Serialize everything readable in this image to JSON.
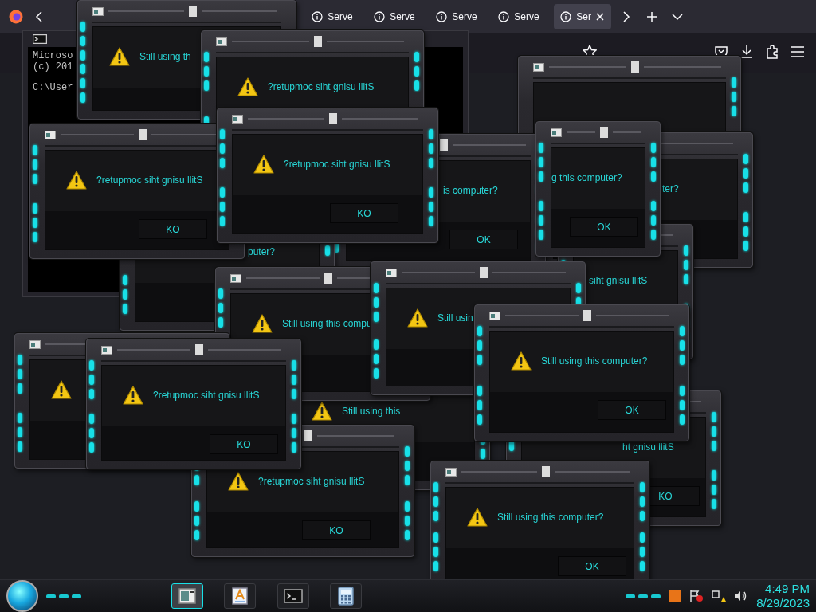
{
  "browser": {
    "tabs": [
      {
        "label": "Serve",
        "selected": false
      },
      {
        "label": "Serve",
        "selected": false
      },
      {
        "label": "Serve",
        "selected": false
      },
      {
        "label": "Serve",
        "selected": false
      },
      {
        "label": "Ser",
        "selected": true
      }
    ]
  },
  "console": {
    "lines": [
      "Microso",
      "(c) 201",
      "C:\\User"
    ]
  },
  "dialogs": [
    {
      "icon": true,
      "message": "Still using th"
    },
    {
      "icon": true,
      "message": "?retupmoc siht gnisu llitS"
    },
    {
      "icon": false
    },
    {
      "icon": false,
      "message": "ter?"
    },
    {
      "icon": false,
      "message": "g this computer?",
      "button": "OK"
    },
    {
      "icon": false,
      "message": "is computer?",
      "button": "OK"
    },
    {
      "icon": false,
      "message": "puter?"
    },
    {
      "icon": true,
      "message": "?retupmoc siht gnisu llitS",
      "button": "KO"
    },
    {
      "icon": true,
      "message": "?retupmoc siht gnisu llitS",
      "button": "KO"
    },
    {
      "icon": true,
      "message": "Still using this"
    },
    {
      "icon": false,
      "message": "siht gnisu llitS"
    },
    {
      "icon": true,
      "message": "Still using this compu"
    },
    {
      "icon": true,
      "message": "Still usin"
    },
    {
      "icon": true,
      "message": "Still using this computer?",
      "button": "OK"
    },
    {
      "icon": true
    },
    {
      "icon": true,
      "message": "?retupmoc siht gnisu llitS",
      "button": "KO"
    },
    {
      "icon": true,
      "message": "?retupmoc siht gnisu llitS",
      "button": "KO"
    },
    {
      "icon": false,
      "message": "ht gnisu llitS",
      "button": "KO"
    },
    {
      "icon": true,
      "message": "Still using this computer?",
      "button": "OK"
    }
  ],
  "taskbar": {
    "apps": [
      {
        "kind": "window",
        "selected": true
      },
      {
        "kind": "editor",
        "selected": false
      },
      {
        "kind": "console",
        "selected": false
      },
      {
        "kind": "calculator",
        "selected": false
      }
    ],
    "clock": {
      "time": "4:49 PM",
      "date": "8/29/2023"
    }
  }
}
